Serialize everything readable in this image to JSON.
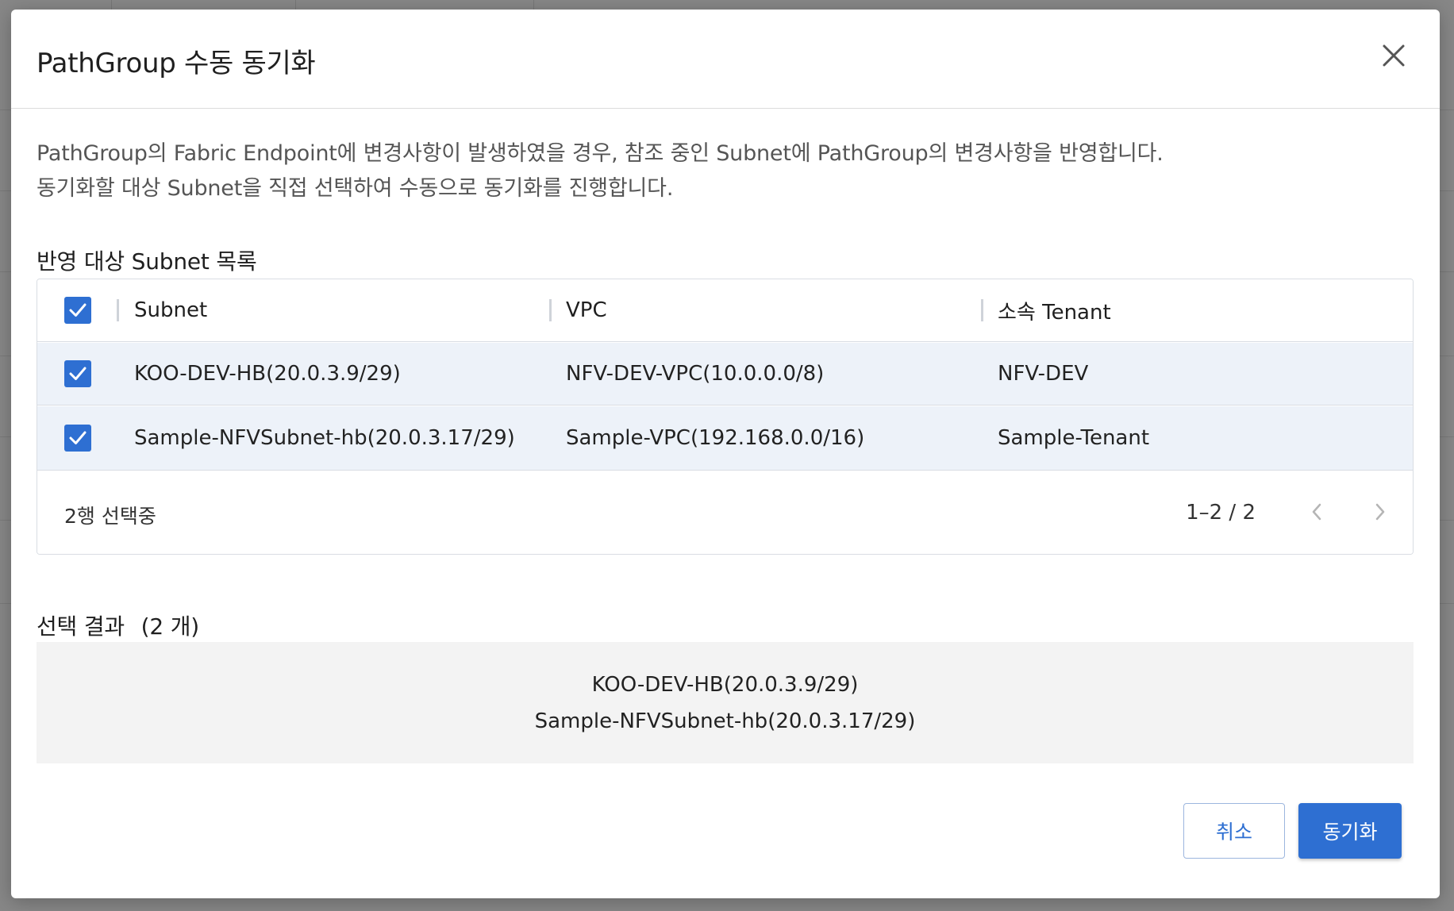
{
  "modal": {
    "title": "PathGroup 수동 동기화",
    "description": [
      "PathGroup의 Fabric Endpoint에 변경사항이 발생하였을 경우, 참조 중인 Subnet에 PathGroup의 변경사항을 반영합니다.",
      "동기화할 대상 Subnet을 직접 선택하여 수동으로 동기화를 진행합니다."
    ],
    "list_section_title": "반영 대상 Subnet 목록",
    "table": {
      "columns": [
        "Subnet",
        "VPC",
        "소속 Tenant"
      ],
      "rows": [
        {
          "subnet": "KOO-DEV-HB(20.0.3.9/29)",
          "vpc": "NFV-DEV-VPC(10.0.0.0/8)",
          "tenant": "NFV-DEV",
          "checked": true
        },
        {
          "subnet": "Sample-NFVSubnet-hb(20.0.3.17/29)",
          "vpc": "Sample-VPC(192.168.0.0/16)",
          "tenant": "Sample-Tenant",
          "checked": true
        }
      ],
      "select_all_checked": true,
      "selection_status": "2행 선택중",
      "pagination": "1–2 / 2"
    },
    "result": {
      "title": "선택 결과",
      "count": "(2 개)",
      "items": [
        "KOO-DEV-HB(20.0.3.9/29)",
        "Sample-NFVSubnet-hb(20.0.3.17/29)"
      ]
    },
    "buttons": {
      "cancel": "취소",
      "sync": "동기화"
    }
  },
  "colors": {
    "accent": "#2e6fd2",
    "selected_row": "#edf2f9",
    "result_bg": "#f3f3f3"
  }
}
